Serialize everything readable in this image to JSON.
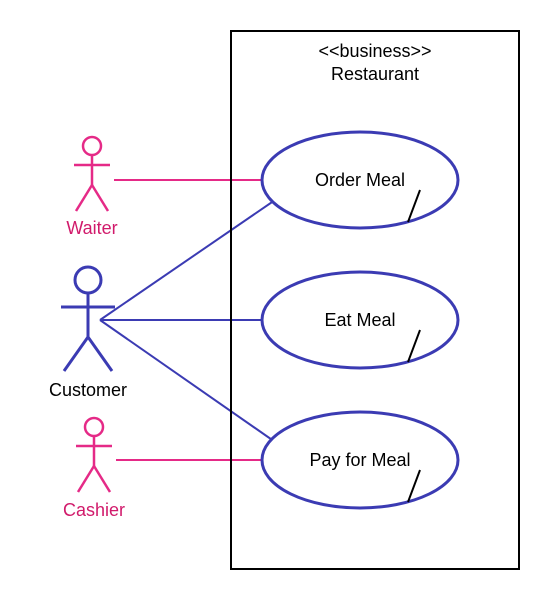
{
  "diagram": {
    "type": "uml-use-case",
    "system": {
      "stereotype": "<<business>>",
      "name": "Restaurant"
    },
    "actors": [
      {
        "id": "waiter",
        "name": "Waiter",
        "role": "secondary"
      },
      {
        "id": "customer",
        "name": "Customer",
        "role": "primary"
      },
      {
        "id": "cashier",
        "name": "Cashier",
        "role": "secondary"
      }
    ],
    "usecases": [
      {
        "id": "order",
        "name": "Order Meal"
      },
      {
        "id": "eat",
        "name": "Eat Meal"
      },
      {
        "id": "pay",
        "name": "Pay for Meal"
      }
    ],
    "associations": [
      {
        "actor": "waiter",
        "usecase": "order"
      },
      {
        "actor": "customer",
        "usecase": "order"
      },
      {
        "actor": "customer",
        "usecase": "eat"
      },
      {
        "actor": "customer",
        "usecase": "pay"
      },
      {
        "actor": "cashier",
        "usecase": "pay"
      }
    ],
    "colors": {
      "primaryActorStroke": "#3b3bb3",
      "secondaryActorStroke": "#e52a87",
      "usecaseStroke": "#3b3bb3",
      "associationStroke": "#3b3bb3",
      "secondaryAssocStroke": "#e52a87",
      "boxStroke": "#000000"
    }
  }
}
